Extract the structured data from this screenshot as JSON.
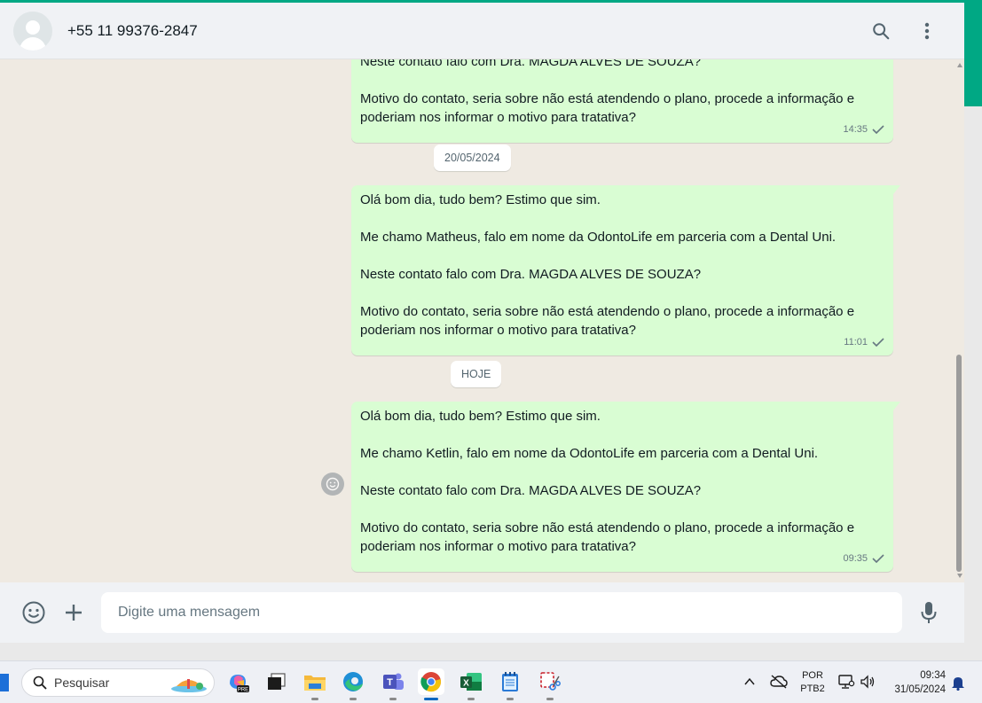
{
  "header": {
    "contact": "+55 11 99376-2847"
  },
  "messages": [
    {
      "partial_top": "Neste contato falo com Dra. MAGDA ALVES DE SOUZA?",
      "body": "Motivo do contato, seria sobre não está atendendo o plano, procede a informação e poderiam nos informar o motivo para tratativa?",
      "time": "14:35"
    }
  ],
  "date_chips": [
    "20/05/2024",
    "HOJE"
  ],
  "full_messages": [
    {
      "lines": [
        "Olá bom dia, tudo bem? Estimo que sim.",
        "Me chamo Matheus, falo em nome da OdontoLife em parceria com a Dental Uni.",
        "Neste contato falo com Dra. MAGDA ALVES DE SOUZA?",
        "Motivo do contato, seria sobre não está atendendo o plano, procede a informação e poderiam nos informar o motivo para tratativa?"
      ],
      "time": "11:01"
    },
    {
      "lines": [
        "Olá bom dia, tudo bem? Estimo que sim.",
        "Me chamo Ketlin, falo em nome da OdontoLife em parceria com a Dental Uni.",
        "Neste contato falo com Dra. MAGDA ALVES DE SOUZA?",
        "Motivo do contato, seria sobre não está atendendo o plano, procede a informação e poderiam nos informar o motivo para tratativa?"
      ],
      "time": "09:35"
    }
  ],
  "composer": {
    "placeholder": "Digite uma mensagem"
  },
  "taskbar": {
    "search_label": "Pesquisar",
    "lang_top": "POR",
    "lang_bottom": "PTB2",
    "time": "09:34",
    "date": "31/05/2024"
  },
  "colors": {
    "accent": "#00a884",
    "bubble_out": "#d9fdd3",
    "chat_bg": "#efeae2",
    "header_bg": "#f0f2f5"
  }
}
